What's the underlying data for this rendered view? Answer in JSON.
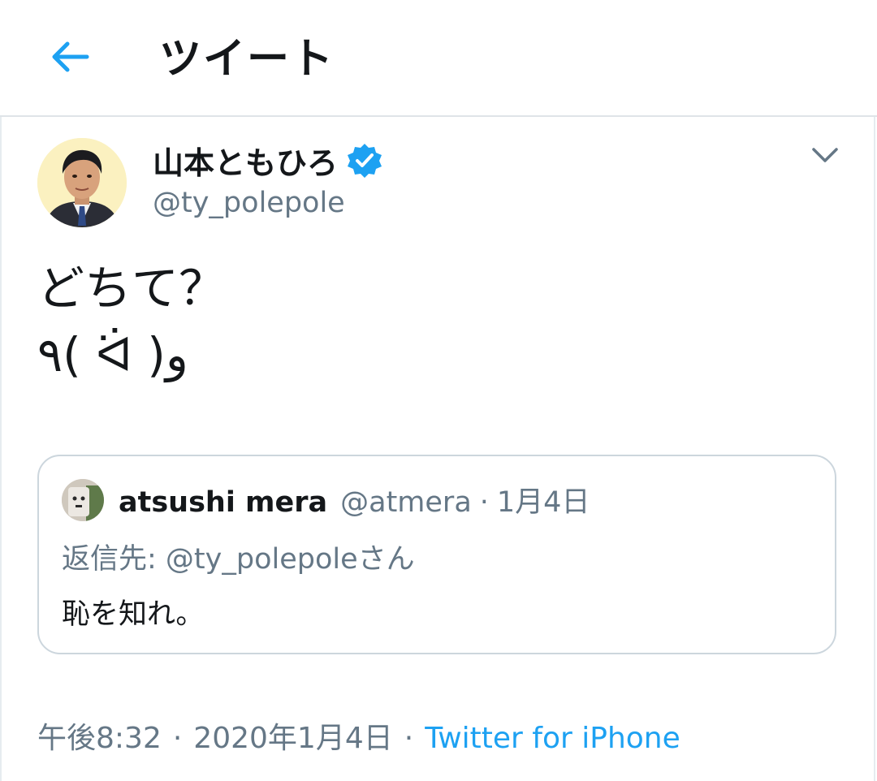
{
  "header": {
    "back_icon": "arrow-left-icon",
    "title": "ツイート"
  },
  "tweet": {
    "author": {
      "name": "山本ともひろ",
      "handle": "@ty_polepole",
      "verified": true
    },
    "text_line1": "どちて？",
    "text_line2": "٩( ᐛ )و",
    "quote": {
      "name": "atsushi mera",
      "handle": "@atmera",
      "separator": "·",
      "date": "1月4日",
      "reply_to": "返信先: @ty_polepoleさん",
      "text": "恥を知れ。"
    },
    "meta": {
      "time": "午後8:32",
      "separator1": "·",
      "date": "2020年1月4日",
      "separator2": "·",
      "source": "Twitter for iPhone"
    }
  },
  "colors": {
    "accent": "#1da1f2",
    "text_primary": "#14171a",
    "text_secondary": "#657786",
    "border": "#ccd6dd"
  }
}
